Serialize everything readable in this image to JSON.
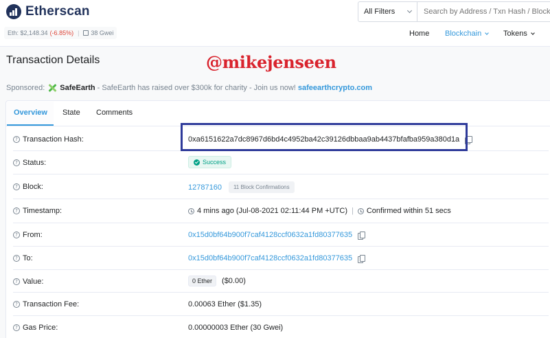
{
  "header": {
    "logo_text": "Etherscan",
    "eth_price_label": "Eth: $2,148.34",
    "eth_change": "(-6.85%)",
    "separator": "|",
    "gas": "38 Gwei",
    "filter_label": "All Filters",
    "search_placeholder": "Search by Address / Txn Hash / Block / Token / Ens",
    "nav": [
      "Home",
      "Blockchain",
      "Tokens"
    ]
  },
  "page": {
    "title": "Transaction Details",
    "watermark": "@mikejenseen"
  },
  "sponsor": {
    "prefix": "Sponsored:",
    "brand": "SafeEarth",
    "text": "- SafeEarth has raised over $300k for charity - Join us now!",
    "link": "safeearthcrypto.com"
  },
  "tabs": [
    "Overview",
    "State",
    "Comments"
  ],
  "details": {
    "tx_hash_label": "Transaction Hash:",
    "tx_hash": "0xa6151622a7dc8967d6bd4c4952ba42c39126dbbaa9ab4437bfafba959a380d1a",
    "status_label": "Status:",
    "status": "Success",
    "block_label": "Block:",
    "block": "12787160",
    "block_confirmations": "11 Block Confirmations",
    "timestamp_label": "Timestamp:",
    "timestamp": "4 mins ago (Jul-08-2021 02:11:44 PM +UTC)",
    "confirmed_within": "Confirmed within 51 secs",
    "from_label": "From:",
    "from": "0x15d0bf64b900f7caf4128ccf0632a1fd80377635",
    "to_label": "To:",
    "to": "0x15d0bf64b900f7caf4128ccf0632a1fd80377635",
    "value_label": "Value:",
    "value_ether": "0 Ether",
    "value_usd": "($0.00)",
    "fee_label": "Transaction Fee:",
    "fee": "0.00063 Ether ($1.35)",
    "gas_price_label": "Gas Price:",
    "gas_price": "0.00000003 Ether (30 Gwei)"
  },
  "colors": {
    "link": "#3498db",
    "success": "#00a186",
    "negative": "#de4437",
    "highlight_box": "#2e3a9a",
    "watermark": "#d9232d"
  }
}
